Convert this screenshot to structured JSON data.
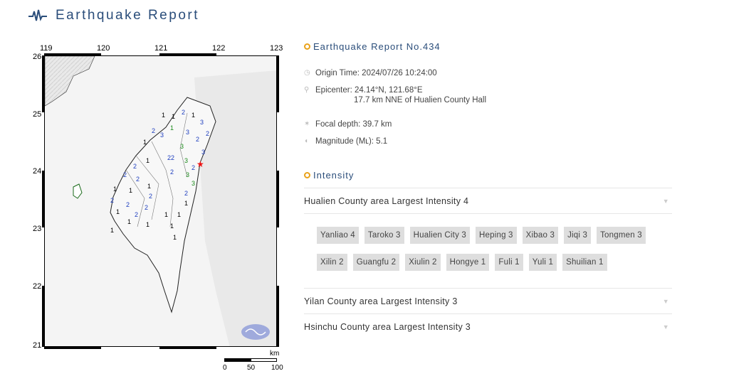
{
  "header": {
    "title": "Earthquake Report",
    "icon": "seismograph-icon"
  },
  "map": {
    "lon_ticks": [
      "119",
      "120",
      "121",
      "122",
      "123"
    ],
    "lat_ticks": [
      "26",
      "25",
      "24",
      "23",
      "22",
      "21"
    ],
    "scale_unit": "km",
    "scale_labels": [
      "0",
      "50",
      "100"
    ],
    "station_intensities": [
      {
        "v": "1",
        "c": "#000"
      },
      {
        "v": "2",
        "c": "#1f3fbf"
      },
      {
        "v": "3",
        "c": "#1a8a1a"
      }
    ],
    "epicenter_color": "#e11"
  },
  "report": {
    "title": "Earthquake Report No.434",
    "origin_time": "Origin Time: 2024/07/26 10:24:00",
    "epicenter": "Epicenter: 24.14°N, 121.68°E",
    "epicenter_desc": "17.7 km NNE of Hualien County Hall",
    "focal_depth": "Focal depth: 39.7 km",
    "magnitude": "Magnitude (Mʟ): 5.1"
  },
  "intensity": {
    "title": "Intensity",
    "areas": [
      {
        "label": "Hualien County area Largest Intensity 4",
        "expanded": true,
        "stations": [
          "Yanliao 4",
          "Taroko 3",
          "Hualien City 3",
          "Heping 3",
          "Xibao 3",
          "Jiqi 3",
          "Tongmen 3",
          "Xilin 2",
          "Guangfu 2",
          "Xiulin 2",
          "Hongye 1",
          "Fuli 1",
          "Yuli 1",
          "Shuilian 1"
        ]
      },
      {
        "label": "Yilan County area Largest Intensity 3",
        "expanded": false
      },
      {
        "label": "Hsinchu County area Largest Intensity 3",
        "expanded": false
      }
    ]
  },
  "colors": {
    "accent": "#e9a21a",
    "title": "#2a4d7a"
  }
}
